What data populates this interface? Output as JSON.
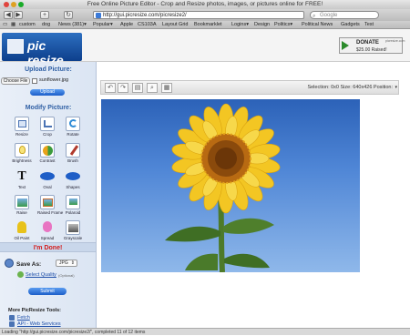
{
  "window": {
    "title": "Free Online Picture Editor - Crop and Resize photos, images, or pictures online for FREE!"
  },
  "toolbar": {
    "back": "◀",
    "forward": "▶",
    "add": "+",
    "reload": "↻",
    "url": "http://gui.picresize.com/picresize2/",
    "search_placeholder": "Google"
  },
  "bookmarks": [
    "custom",
    "dog",
    "News (381)▾",
    "Popular▾",
    "Apple",
    "CS103A",
    "Layout Grid",
    "Bookmarklet",
    "Logins▾",
    "Design",
    "Politics▾",
    "Political News",
    "Gadgets",
    "Test"
  ],
  "logo": {
    "text": "pic resize"
  },
  "donate": {
    "label": "DONATE",
    "amount": "$25.00 Raised!",
    "badge": "picresize.com"
  },
  "sidebar": {
    "upload_title": "Upload Picture:",
    "choose_file": "Choose File",
    "file_name": "sunflower.jpg",
    "upload_button": "Upload",
    "modify_title": "Modify Picture:",
    "tools": [
      "Resize",
      "Crop",
      "Rotate",
      "Brightness",
      "Contrast",
      "Brush",
      "Text",
      "Oval",
      "Shapes",
      "Raise",
      "Raised Frame",
      "Polaroid",
      "Oil Paint",
      "Spread",
      "Grayscale"
    ],
    "done_title": "I'm Done!",
    "save_as": "Save As:",
    "format": "JPG",
    "select_quality": "Select Quality",
    "optional": "(Optional)",
    "submit_button": "Submit",
    "more_title": "More PicResize Tools:",
    "more_links": [
      "Fetch",
      "API - Web Services"
    ]
  },
  "selection_info": "Selection: 0x0  Size: 640x426  Position:",
  "statusbar": "Loading \"http://gui.picresize.com/picresize2/\", completed 11 of 12 items",
  "colors": {
    "accent": "#2f5fa4",
    "done": "#d41c1c",
    "logo_bg": "#0d3f8c",
    "sky": "#3f76cb",
    "petal": "#f3c623"
  }
}
